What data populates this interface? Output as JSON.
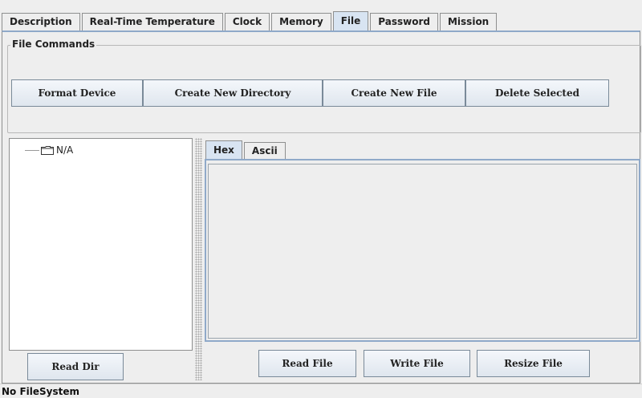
{
  "tabs": [
    {
      "label": "Description"
    },
    {
      "label": "Real-Time Temperature"
    },
    {
      "label": "Clock"
    },
    {
      "label": "Memory"
    },
    {
      "label": "File"
    },
    {
      "label": "Password"
    },
    {
      "label": "Mission"
    }
  ],
  "file_commands": {
    "title": "File Commands",
    "format_label": "Format Device",
    "create_dir_label": "Create New Directory",
    "create_file_label": "Create New File",
    "delete_label": "Delete Selected"
  },
  "tree": {
    "root_label": "N/A",
    "read_dir_label": "Read Dir"
  },
  "viewer": {
    "tabs": [
      {
        "label": "Hex"
      },
      {
        "label": "Ascii"
      }
    ],
    "read_file_label": "Read File",
    "write_file_label": "Write File",
    "resize_file_label": "Resize File"
  },
  "status": "No FileSystem",
  "colors": {
    "selected_tab": "#d8e4f2",
    "border_accent": "#8fa9c9"
  },
  "icons": {
    "tree_node": "folder-icon"
  }
}
